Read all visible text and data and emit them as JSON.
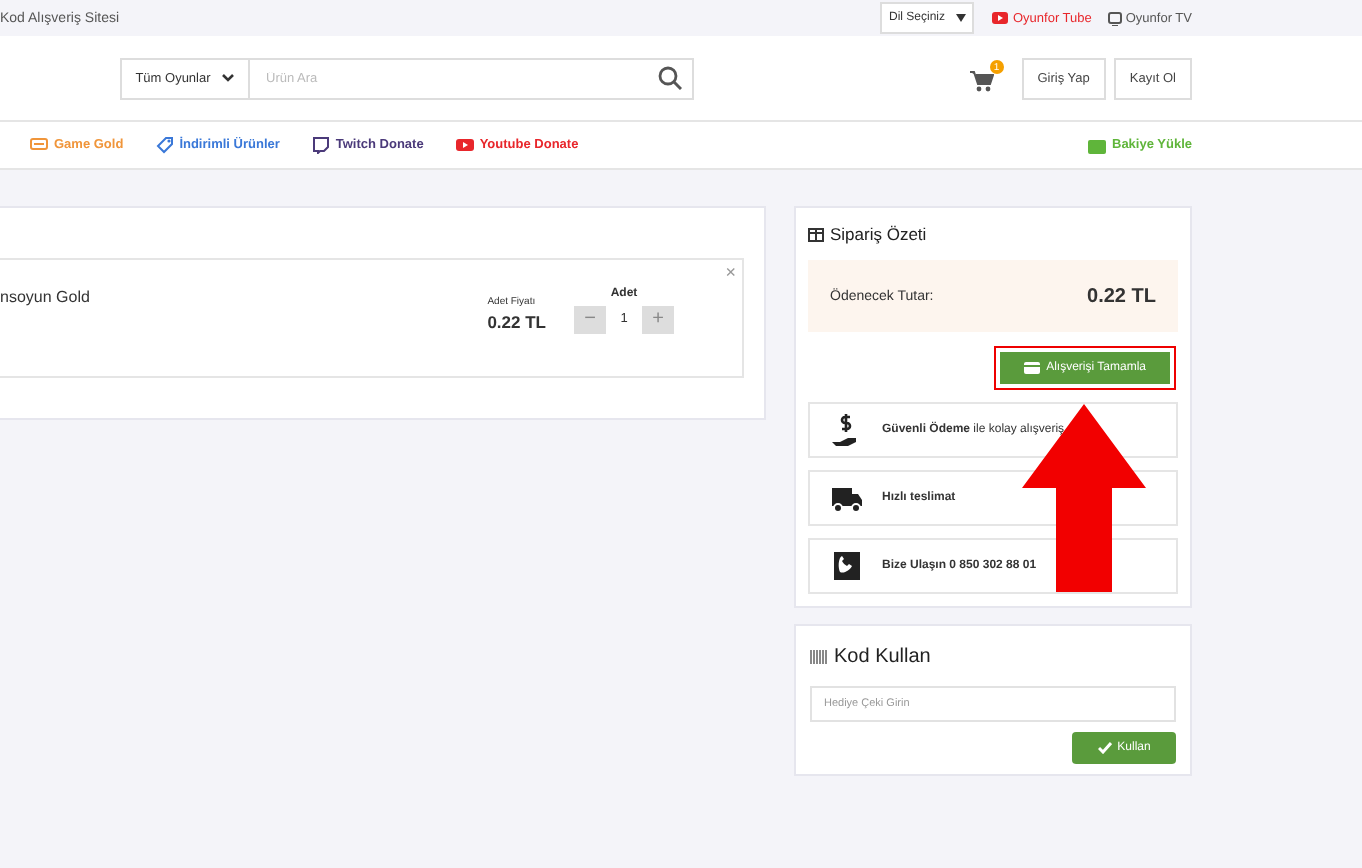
{
  "top_bar": {
    "site_tagline": "Kod Alışveriş Sitesi",
    "language_select": "Dil Seçiniz",
    "links": [
      {
        "label": "Oyunfor Tube",
        "kind": "youtube"
      },
      {
        "label": "Oyunfor TV",
        "kind": "tv"
      }
    ]
  },
  "header": {
    "category_select": "Tüm Oyunlar",
    "search": {
      "placeholder": "Ürün Ara"
    },
    "cart_count": "1",
    "buttons": [
      "Giriş Yap",
      "Kayıt Ol"
    ]
  },
  "nav": {
    "items": [
      {
        "label": "Game Gold",
        "kind": "gold",
        "color": "#f0953a"
      },
      {
        "label": "İndirimli Ürünler",
        "kind": "discount",
        "color": "#3a78d8"
      },
      {
        "label": "Twitch Donate",
        "kind": "twitch",
        "color": "#4b3a7a"
      },
      {
        "label": "Youtube Donate",
        "kind": "youtube",
        "color": "#e8262b"
      }
    ],
    "balance": {
      "label": "Bakiye Yükle",
      "color": "#5fb53a"
    }
  },
  "cart": {
    "items": [
      {
        "name": "nsoyun Gold",
        "unit_price_label": "Adet Fiyatı",
        "unit_price": "0.22 TL",
        "quantity_label": "Adet",
        "quantity": "1",
        "minus": "−",
        "plus": "+",
        "remove": "×"
      }
    ]
  },
  "order_summary": {
    "title": "Sipariş Özeti",
    "total_label": "Ödenecek Tutar:",
    "total": "0.22 TL",
    "checkout_button": "Alışverişi Tamamla",
    "features": [
      {
        "kind": "payment",
        "bold": "Güvenli Ödeme",
        "text": " ile kolay alışveriş"
      },
      {
        "kind": "delivery",
        "bold": "Hızlı teslimat"
      },
      {
        "kind": "phone",
        "bold": "Bize Ulaşın 0 850 302 88 01"
      }
    ]
  },
  "coupon": {
    "title": "Kod Kullan",
    "placeholder": "Hediye Çeki Girin",
    "button": "Kullan"
  }
}
